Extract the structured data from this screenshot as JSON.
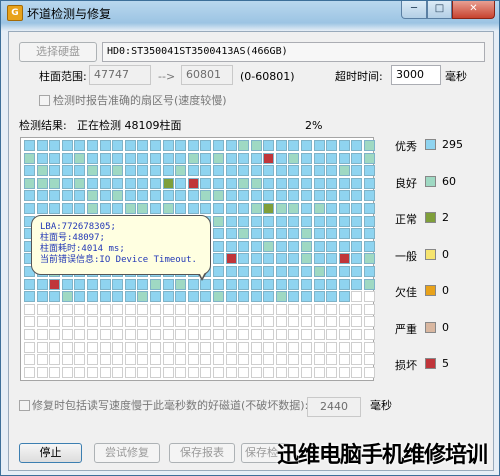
{
  "window": {
    "title": "坏道检测与修复",
    "app_icon": "G",
    "min_glyph": "─",
    "max_glyph": "□",
    "close_glyph": "✕"
  },
  "disk": {
    "select_button": "选择硬盘",
    "name": "HD0:ST350041ST3500413AS(466GB)"
  },
  "range": {
    "label": "柱面范围:",
    "start": "47747",
    "arrow": "-->",
    "end": "60801",
    "hint": "(0-60801)"
  },
  "timeout": {
    "label": "超时时间:",
    "value": "3000",
    "unit": "毫秒"
  },
  "exact_sector": {
    "label": "检测时报告准确的扇区号(速度较慢)"
  },
  "status": {
    "label": "检测结果:",
    "text": "正在检测 48109柱面",
    "percent": "2%"
  },
  "legend": [
    {
      "label": "优秀",
      "count": "295",
      "color": "#8fd4f0"
    },
    {
      "label": "良好",
      "count": "60",
      "color": "#9fd9c3"
    },
    {
      "label": "正常",
      "count": "2",
      "color": "#7f9f3a"
    },
    {
      "label": "一般",
      "count": "0",
      "color": "#f6e46e"
    },
    {
      "label": "欠佳",
      "count": "0",
      "color": "#e8a21a"
    },
    {
      "label": "严重",
      "count": "0",
      "color": "#d9b7a0"
    },
    {
      "label": "损坏",
      "count": "5",
      "color": "#c0353a"
    }
  ],
  "tooltip": {
    "lines": [
      "LBA:772678305;",
      "柱面号:48097;",
      "柱面耗时:4014 ms;",
      "当前错误信息:IO Device Timeout."
    ]
  },
  "repair_option": {
    "label": "修复时包括读写速度慢于此毫秒数的好磁道(不破坏数据):",
    "value": "2440",
    "unit": "毫秒"
  },
  "buttons": {
    "stop": "停止",
    "try_repair": "尝试修复",
    "save_report": "保存报表",
    "save_check": "保存检"
  },
  "watermark": "迅维电脑手机维修培训"
}
